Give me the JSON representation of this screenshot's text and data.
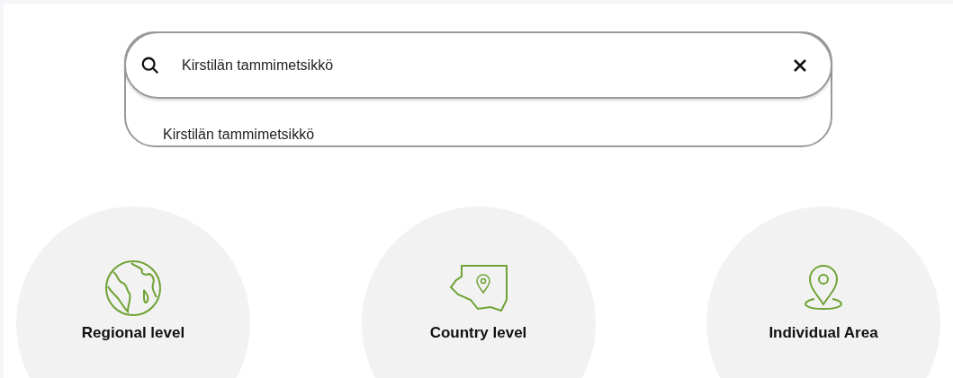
{
  "search": {
    "value": "Kirstilän tammimetsikkö",
    "suggestions": [
      "Kirstilän tammimetsikkö"
    ]
  },
  "cards": [
    {
      "kind": "globe",
      "title": "Regional level"
    },
    {
      "kind": "country",
      "title": "Country level"
    },
    {
      "kind": "pin",
      "title": "Individual Area"
    }
  ]
}
